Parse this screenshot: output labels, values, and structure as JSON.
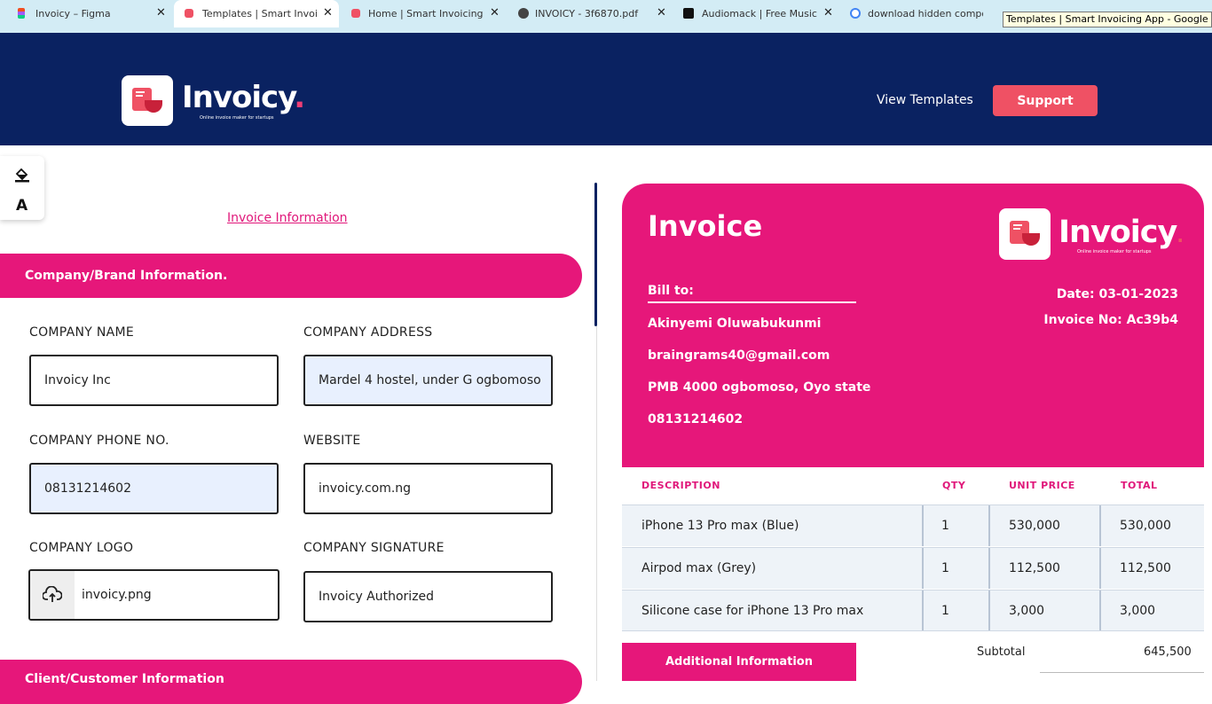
{
  "browser": {
    "tabs": [
      {
        "title": "Invoicy – Figma",
        "favicon": "figma-icon"
      },
      {
        "title": "Templates | Smart Invoicing",
        "favicon": "invoicy-icon"
      },
      {
        "title": "Home | Smart Invoicing App",
        "favicon": "invoicy-icon"
      },
      {
        "title": "INVOICY - 3f6870.pdf",
        "favicon": "globe-icon"
      },
      {
        "title": "Audiomack | Free Music Sh",
        "favicon": "audiomack-icon"
      },
      {
        "title": "download hidden compone",
        "favicon": "google-icon"
      }
    ],
    "tooltip": "Templates | Smart Invoicing App - Google Chrome"
  },
  "header": {
    "brand": "Invoicy",
    "brand_dot": ".",
    "tagline": "Online invoice maker for startups",
    "nav_view_templates": "View Templates",
    "support_label": "Support"
  },
  "form": {
    "invoice_info_link": "Invoice Information",
    "company_section": "Company/Brand Information.",
    "client_section": "Client/Customer Information",
    "company_name_label": "COMPANY NAME",
    "company_name": "Invoicy Inc",
    "company_address_label": "COMPANY ADDRESS",
    "company_address": "Mardel 4 hostel, under G ogbomoso",
    "company_phone_label": "COMPANY PHONE NO.",
    "company_phone": "08131214602",
    "website_label": "WEBSITE",
    "website": "invoicy.com.ng",
    "company_logo_label": "COMPANY LOGO",
    "company_logo": "invoicy.png",
    "company_signature_label": "COMPANY SIGNATURE",
    "company_signature": "Invoicy Authorized"
  },
  "preview": {
    "title": "Invoice",
    "bill_to": "Bill to:",
    "client_name": "Akinyemi Oluwabukunmi",
    "client_email": "braingrams40@gmail.com",
    "client_address": "PMB 4000 ogbomoso, Oyo state",
    "client_phone": "08131214602",
    "date": "Date: 03-01-2023",
    "invoice_no": "Invoice No: Ac39b4",
    "columns": [
      "DESCRIPTION",
      "QTY",
      "UNIT PRICE",
      "TOTAL"
    ],
    "rows": [
      {
        "description": "iPhone 13 Pro max (Blue)",
        "qty": "1",
        "unit_price": "530,000",
        "total": "530,000"
      },
      {
        "description": "Airpod max (Grey)",
        "qty": "1",
        "unit_price": "112,500",
        "total": "112,500"
      },
      {
        "description": "Silicone case for iPhone 13 Pro max",
        "qty": "1",
        "unit_price": "3,000",
        "total": "3,000"
      }
    ],
    "additional_info": "Additional Information",
    "subtotal_label": "Subtotal",
    "subtotal_value": "645,500"
  },
  "colors": {
    "navy": "#0a2261",
    "pink": "#e6177a",
    "coral": "#ef5164"
  }
}
